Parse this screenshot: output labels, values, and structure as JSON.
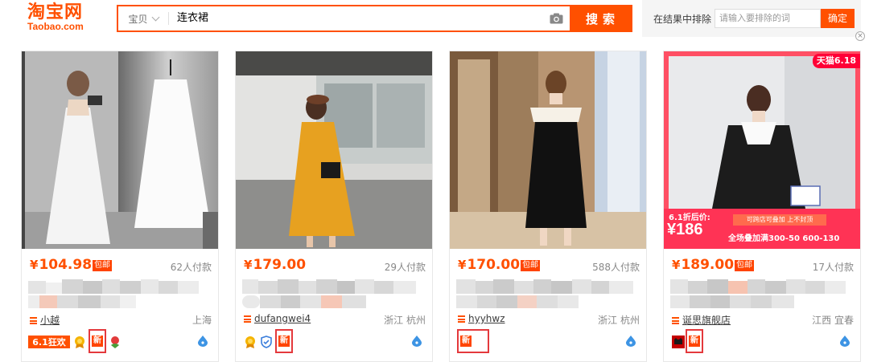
{
  "header": {
    "logo_cn": "淘宝网",
    "logo_en": "Taobao.com",
    "search": {
      "category": "宝贝",
      "query": "连衣裙",
      "camera_icon": "camera-icon",
      "button": "搜索"
    },
    "exclude": {
      "label": "在结果中排除",
      "placeholder": "请输入要排除的词",
      "confirm": "确定"
    },
    "close": "×"
  },
  "products": [
    {
      "price": "104.98",
      "yen": "¥",
      "free_shipping": "包邮",
      "sales": "62人付款",
      "shop": "小越",
      "location": "上海",
      "promo": "6.1狂欢",
      "new_label": "新"
    },
    {
      "price": "179.00",
      "yen": "¥",
      "free_shipping": "",
      "sales": "29人付款",
      "shop": "dufangwei4",
      "location": "浙江 杭州",
      "new_label": "新"
    },
    {
      "price": "170.00",
      "yen": "¥",
      "free_shipping": "包邮",
      "sales": "588人付款",
      "shop": "hyyhwz",
      "location": "浙江 杭州",
      "new_label": "新"
    },
    {
      "price": "189.00",
      "yen": "¥",
      "free_shipping": "包邮",
      "sales": "17人付款",
      "shop": "诞思旗舰店",
      "location": "江西 宜春",
      "new_label": "新",
      "banner": {
        "tmall": "天猫6.18",
        "promo_label": "6.1折后价:",
        "promo_price": "¥186",
        "cross_store": "可跨店可叠加 上不封顶",
        "discount": "全场叠加满300-50 600-130"
      }
    }
  ],
  "colors": {
    "accent": "#ff5000",
    "badge_red": "#e4393c"
  }
}
